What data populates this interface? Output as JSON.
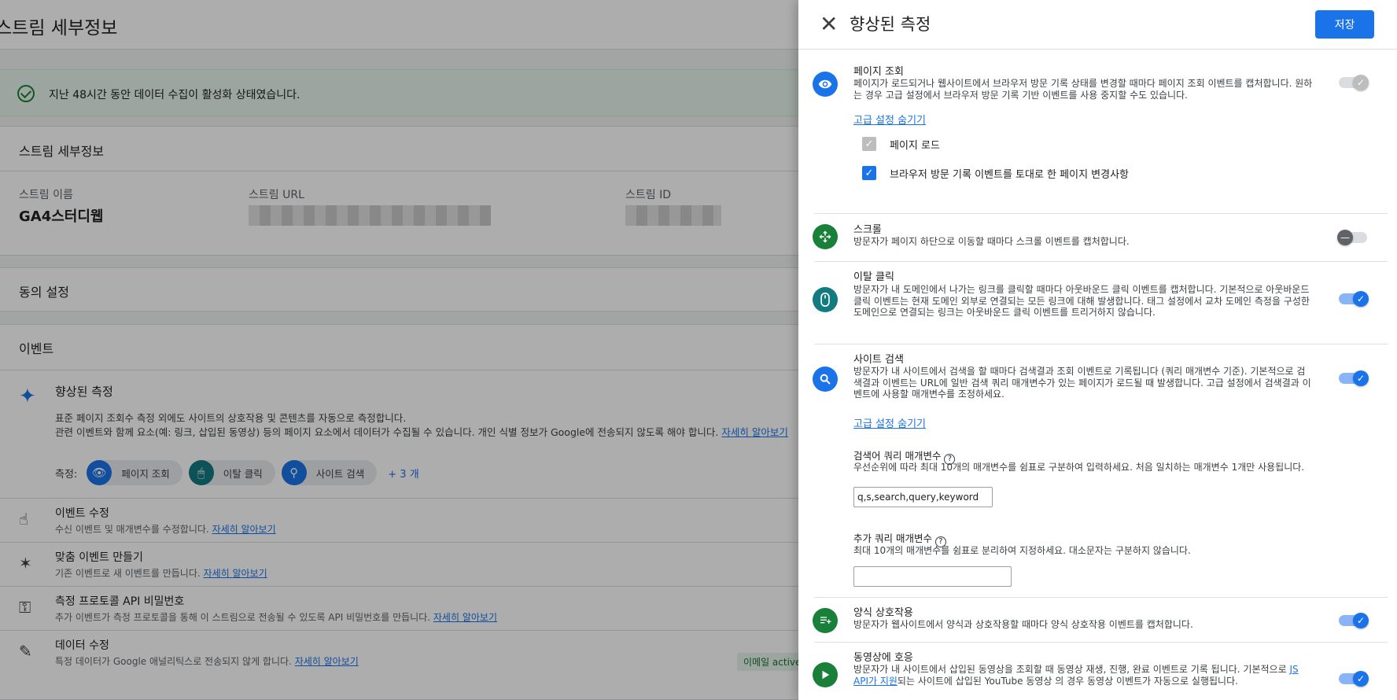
{
  "background": {
    "header_title": "스트림 세부정보",
    "banner_text": "지난 48시간 동안 데이터 수집이 활성화 상태였습니다.",
    "details": {
      "heading": "스트림 세부정보",
      "stream_name_label": "스트림 이름",
      "stream_name_value": "GA4스터디웹",
      "stream_url_label": "스트림 URL",
      "stream_id_label": "스트림 ID"
    },
    "consent_heading": "동의 설정",
    "events": {
      "heading": "이벤트",
      "enhanced_title": "향상된 측정",
      "enhanced_desc_1": "표준 페이지 조회수 측정 외에도 사이트의 상호작용 및 콘텐츠를 자동으로 측정합니다.",
      "enhanced_desc_2": "관련 이벤트와 함께 요소(예: 링크, 삽입된 동영상) 등의 페이지 요소에서 데이터가 수집될 수 있습니다. 개인 식별 정보가 Google에 전송되지 않도록 해야 합니다.",
      "learn_more": "자세히 알아보기",
      "measure_label": "측정:",
      "chips": [
        "페이지 조회",
        "이탈 클릭",
        "사이트 검색"
      ],
      "more": "+ 3 개",
      "rows": [
        {
          "title": "이벤트 수정",
          "desc": "수신 이벤트 및 매개변수를 수정합니다.",
          "link": "자세히 알아보기"
        },
        {
          "title": "맞춤 이벤트 만들기",
          "desc": "기존 이벤트로 새 이벤트를 만듭니다.",
          "link": "자세히 알아보기"
        },
        {
          "title": "측정 프로토콜 API 비밀번호",
          "desc": "추가 이벤트가 측정 프로토콜을 통해 이 스트림으로 전송될 수 있도록 API 비밀번호를 만듭니다.",
          "link": "자세히 알아보기"
        },
        {
          "title": "데이터 수정",
          "desc": "특정 데이터가 Google 애널리틱스로 전송되지 않게 합니다.",
          "link": "자세히 알아보기"
        }
      ],
      "badge": "이메일 active"
    }
  },
  "drawer": {
    "title": "향상된 측정",
    "save_label": "저장",
    "page_view": {
      "title": "페이지 조회",
      "desc": "페이지가 로드되거나 웹사이트에서 브라우저 방문 기록 상태를 변경할 때마다 페이지 조회 이벤트를 캡처합니다. 원하는 경우 고급 설정에서 브라우저 방문 기록 기반 이벤트를 사용 중지할 수도 있습니다.",
      "advanced_link": "고급 설정 숨기기",
      "checkbox_1": "페이지 로드",
      "checkbox_2": "브라우저 방문 기록 이벤트를 토대로 한 페이지 변경사항"
    },
    "scroll": {
      "title": "스크롤",
      "desc": "방문자가 페이지 하단으로 이동할 때마다 스크롤 이벤트를 캡처합니다."
    },
    "outbound": {
      "title": "이탈 클릭",
      "desc": "방문자가 내 도메인에서 나가는 링크를 클릭할 때마다 아웃바운드 클릭 이벤트를 캡처합니다. 기본적으로 아웃바운드 클릭 이벤트는 현재 도메인 외부로 연결되는 모든 링크에 대해 발생합니다. 태그 설정에서 교차 도메인 측정을 구성한 도메인으로 연결되는 링크는 아웃바운드 클릭 이벤트를 트리거하지 않습니다."
    },
    "site_search": {
      "title": "사이트 검색",
      "desc": "방문자가 내 사이트에서 검색을 할 때마다 검색결과 조회 이벤트로 기록됩니다 (쿼리 매개변수 기준). 기본적으로 검색결과 이벤트는 URL에 일반 검색 쿼리 매개변수가 있는 페이지가 로드될 때 발생합니다. 고급 설정에서 검색결과 이벤트에 사용할 매개변수를 조정하세요.",
      "advanced_link": "고급 설정 숨기기",
      "query_param_title": "검색어 쿼리 매개변수",
      "query_param_desc": "우선순위에 따라 최대 10개의 매개변수를 쉼표로 구분하여 입력하세요. 처음 일치하는 매개변수 1개만 사용됩니다.",
      "query_param_value": "q,s,search,query,keyword",
      "extra_param_title": "추가 쿼리 매개변수",
      "extra_param_desc": "최대 10개의 매개변수를 쉼표로 분리하여 지정하세요. 대소문자는 구분하지 않습니다.",
      "extra_param_value": ""
    },
    "form": {
      "title": "양식 상호작용",
      "desc": "방문자가 웹사이트에서 양식과 상호작용할 때마다 양식 상호작용 이벤트를 캡처합니다."
    },
    "video": {
      "title": "동영상에 호응",
      "desc_before": "방문자가 내 사이트에서 삽입된 동영상을 조회할 때 동영상 재생, 진행, 완료 이벤트로 기록 됩니다. 기본적으로 ",
      "desc_link": "JS API가 지원",
      "desc_after": "되는 사이트에 삽입된 YouTube 동영상 의 경우 동영상 이벤트가 자동으로 실행됩니다."
    }
  },
  "colors": {
    "accent": "#1a73e8",
    "green": "#188038",
    "teal": "#137a7f"
  }
}
